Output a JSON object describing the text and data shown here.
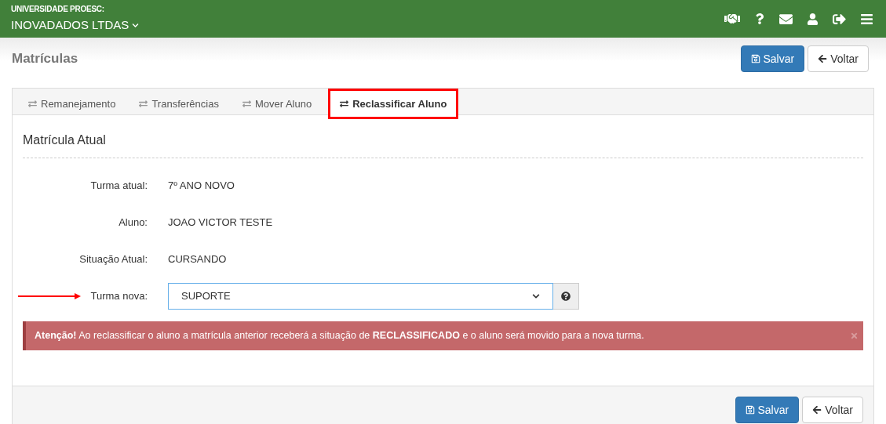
{
  "header": {
    "institution": "UNIVERSIDADE PROESC:",
    "company": "INOVADADOS LTDAS"
  },
  "page_title": "Matrículas",
  "top_buttons": [
    {
      "kind": "save",
      "label": "Salvar"
    },
    {
      "kind": "back",
      "label": "Voltar"
    }
  ],
  "tabs": [
    {
      "label": "Remanejamento",
      "selected": false,
      "highlighted": false
    },
    {
      "label": "Transferências",
      "selected": false,
      "highlighted": false
    },
    {
      "label": "Mover Aluno",
      "selected": false,
      "highlighted": false
    },
    {
      "label": "Reclassificar Aluno",
      "selected": true,
      "highlighted": true
    }
  ],
  "section_title": "Matrícula Atual",
  "fields": [
    {
      "kind": "text",
      "label": "Turma atual:",
      "value": "7º ANO NOVO",
      "arrow": false
    },
    {
      "kind": "text",
      "label": "Aluno:",
      "value": "JOAO VICTOR TESTE",
      "arrow": false
    },
    {
      "kind": "text",
      "label": "Situação Atual:",
      "value": "CURSANDO",
      "arrow": false
    },
    {
      "kind": "select",
      "label": "Turma nova:",
      "value": "SUPORTE",
      "arrow": true
    }
  ],
  "alert": {
    "text": "**Atenção!** Ao reclassificar o aluno a matrícula anterior receberá a situação de **RECLASSIFICADO** e o aluno será movido para a nova turma."
  },
  "footer_buttons": [
    {
      "kind": "save",
      "label": "Salvar"
    },
    {
      "kind": "back",
      "label": "Voltar"
    }
  ]
}
